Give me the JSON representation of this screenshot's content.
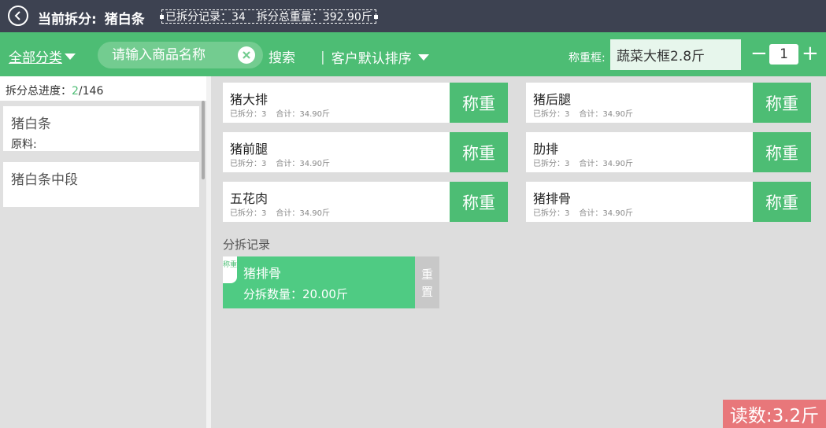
{
  "header": {
    "title_label": "当前拆分:",
    "title_value": "猪白条",
    "records_label": "已拆分记录：",
    "records_value": "34",
    "weight_label": "拆分总重量：",
    "weight_value": "392.90斤"
  },
  "toolbar": {
    "category": "全部分类",
    "search_placeholder": "请输入商品名称",
    "search_button": "搜索",
    "sort_label": "客户默认排序",
    "frame_label": "称重框:",
    "frame_value": "蔬菜大框2.8斤",
    "quantity": "1"
  },
  "left": {
    "progress_label": "拆分总进度：",
    "progress_done": "2",
    "progress_total": "/146",
    "items": [
      {
        "name": "猪白条",
        "sub": "原料:"
      },
      {
        "name": "猪白条中段",
        "sub": ""
      }
    ]
  },
  "products": [
    {
      "name": "猪大排",
      "split_label": "已拆分：",
      "split_value": "3",
      "total_label": "合计：",
      "total_value": "34.90斤",
      "button": "称重"
    },
    {
      "name": "猪后腿",
      "split_label": "已拆分：",
      "split_value": "3",
      "total_label": "合计：",
      "total_value": "34.90斤",
      "button": "称重"
    },
    {
      "name": "猪前腿",
      "split_label": "已拆分：",
      "split_value": "3",
      "total_label": "合计：",
      "total_value": "34.90斤",
      "button": "称重"
    },
    {
      "name": "肋排",
      "split_label": "已拆分：",
      "split_value": "3",
      "total_label": "合计：",
      "total_value": "34.90斤",
      "button": "称重"
    },
    {
      "name": "五花肉",
      "split_label": "已拆分：",
      "split_value": "3",
      "total_label": "合计：",
      "total_value": "34.90斤",
      "button": "称重"
    },
    {
      "name": "猪排骨",
      "split_label": "已拆分：",
      "split_value": "3",
      "total_label": "合计：",
      "total_value": "34.90斤",
      "button": "称重"
    }
  ],
  "records": {
    "title": "分拆记录",
    "item": {
      "tag": "称重",
      "name": "猪排骨",
      "qty_label": "分拆数量：",
      "qty_value": "20.00斤",
      "reset": "重置"
    }
  },
  "reading": "读数:3.2斤",
  "colors": {
    "header_bg": "#3d4251",
    "accent": "#4dbd74",
    "reading_bg": "#e8777a"
  }
}
